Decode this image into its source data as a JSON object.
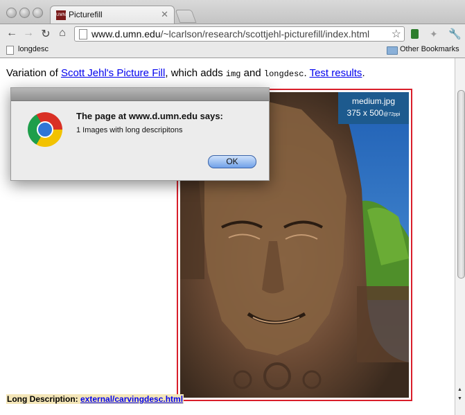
{
  "browser": {
    "tab_title": "Picturefill",
    "tab_favicon_text": "UMN",
    "url_host": "www.d.umn.edu",
    "url_path": "/~lcarlson/research/scottjehl-picturefill/index.html",
    "bookmark": "longdesc",
    "other_bookmarks": "Other Bookmarks",
    "icons": {
      "back": "back-arrow-icon",
      "forward": "forward-arrow-icon",
      "reload": "reload-icon",
      "home": "home-icon",
      "star": "star-icon",
      "wrench": "wrench-icon"
    }
  },
  "page": {
    "intro_prefix": "Variation of ",
    "intro_link": "Scott Jehl's Picture Fill",
    "intro_mid": ", which adds ",
    "code_img": "img",
    "intro_and": " and ",
    "code_longdesc": "longdesc",
    "intro_dot": ". ",
    "test_link": "Test results",
    "intro_end": ".",
    "image_caption_name": "medium.jpg",
    "image_caption_size": "375 x 500",
    "image_caption_ppi": "@72ppi",
    "longdesc_label": "Long Description: ",
    "longdesc_link": "external/carvingdesc.html"
  },
  "dialog": {
    "heading": "The page at www.d.umn.edu says:",
    "message": "1 Images with long descripitons",
    "ok_label": "OK"
  },
  "colors": {
    "link": "#0000ee",
    "image_border": "#d91e2a",
    "caption_bg": "#1d5a8e"
  }
}
